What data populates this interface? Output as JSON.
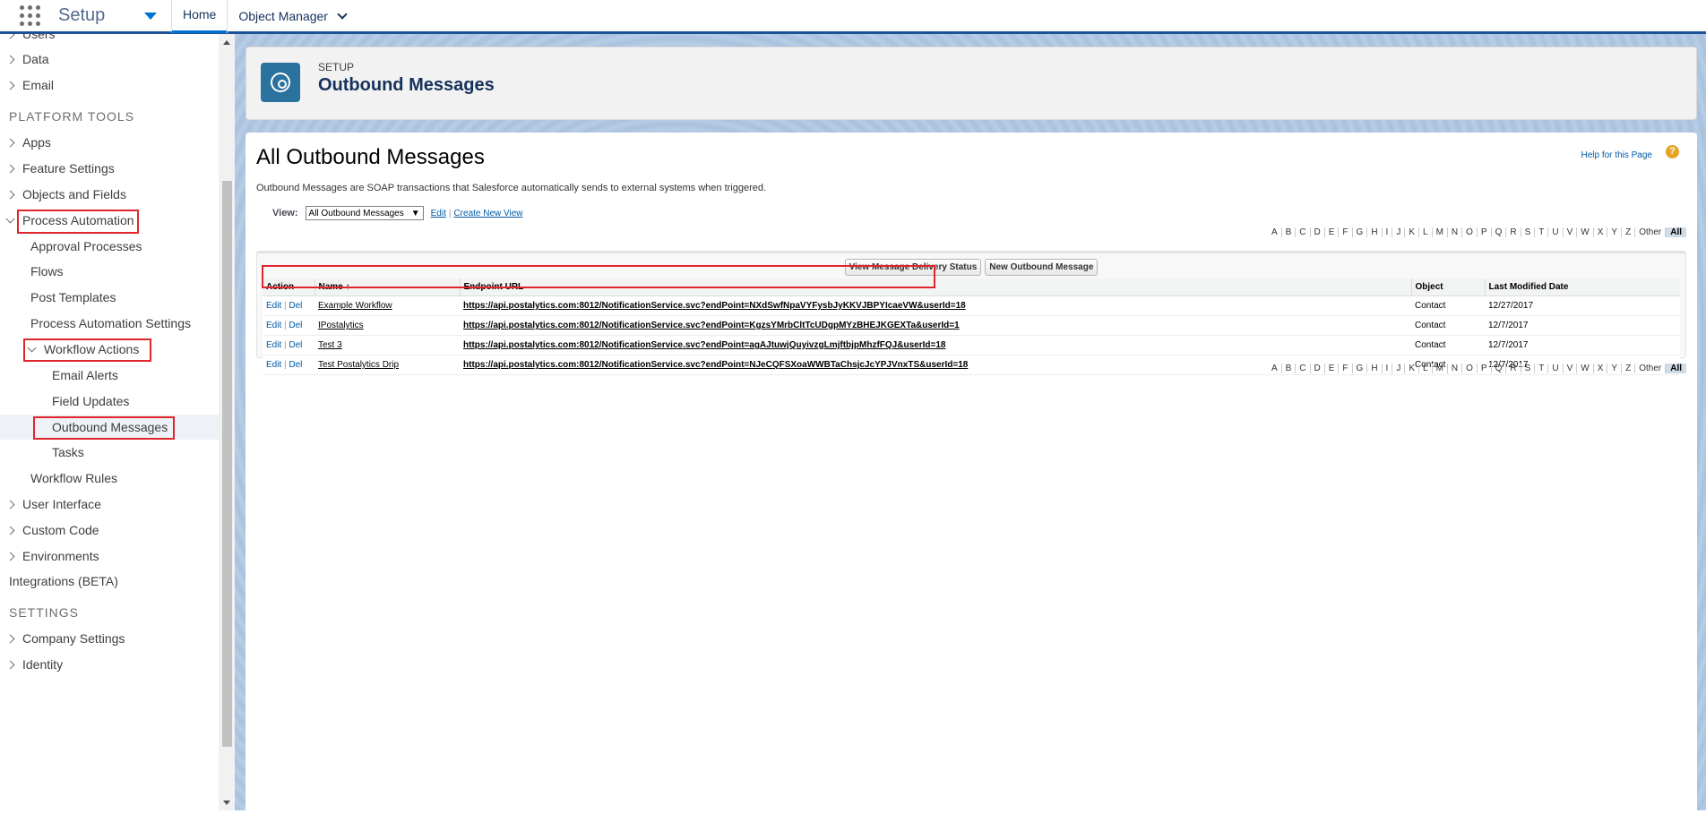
{
  "topbar": {
    "app_name": "Setup",
    "tabs": [
      {
        "label": "Home"
      },
      {
        "label": "Object Manager"
      }
    ]
  },
  "sidebar": {
    "items": {
      "users": "Users",
      "data": "Data",
      "email": "Email",
      "platform_tools": "PLATFORM TOOLS",
      "apps": "Apps",
      "feature_settings": "Feature Settings",
      "objects_and_fields": "Objects and Fields",
      "process_automation": "Process Automation",
      "approval_processes": "Approval Processes",
      "flows": "Flows",
      "post_templates": "Post Templates",
      "process_automation_settings": "Process Automation Settings",
      "workflow_actions": "Workflow Actions",
      "email_alerts": "Email Alerts",
      "field_updates": "Field Updates",
      "outbound_messages": "Outbound Messages",
      "tasks": "Tasks",
      "workflow_rules": "Workflow Rules",
      "user_interface": "User Interface",
      "custom_code": "Custom Code",
      "environments": "Environments",
      "integrations": "Integrations (BETA)",
      "settings": "SETTINGS",
      "company_settings": "Company Settings",
      "identity": "Identity"
    }
  },
  "header": {
    "eyebrow": "SETUP",
    "title": "Outbound Messages"
  },
  "content": {
    "title": "All Outbound Messages",
    "help": "Help for this Page",
    "help_icon": "?",
    "description": "Outbound Messages are SOAP transactions that Salesforce automatically sends to external systems when triggered.",
    "view_label": "View:",
    "view_selected": "All Outbound Messages",
    "edit_link": "Edit",
    "create_view_link": "Create New View",
    "alphabet": [
      "A",
      "B",
      "C",
      "D",
      "E",
      "F",
      "G",
      "H",
      "I",
      "J",
      "K",
      "L",
      "M",
      "N",
      "O",
      "P",
      "Q",
      "R",
      "S",
      "T",
      "U",
      "V",
      "W",
      "X",
      "Y",
      "Z",
      "Other",
      "All"
    ],
    "buttons": {
      "delivery_status": "View Message Delivery Status",
      "new_message": "New Outbound Message"
    },
    "columns": {
      "action": "Action",
      "name": "Name",
      "sort_arrow": "↑",
      "endpoint": "Endpoint URL",
      "object": "Object",
      "modified": "Last Modified Date"
    },
    "action_edit": "Edit",
    "action_del": "Del",
    "rows": [
      {
        "name": "Example Workflow",
        "endpoint": "https://api.postalytics.com:8012/NotificationService.svc?endPoint=NXdSwfNpaVYFysbJyKKVJBPYIcaeVW&userId=18",
        "object": "Contact",
        "modified": "12/27/2017"
      },
      {
        "name": "IPostalytics",
        "endpoint": "https://api.postalytics.com:8012/NotificationService.svc?endPoint=KgzsYMrbCltTcUDgpMYzBHEJKGEXTa&userId=1",
        "object": "Contact",
        "modified": "12/7/2017"
      },
      {
        "name": "Test 3",
        "endpoint": "https://api.postalytics.com:8012/NotificationService.svc?endPoint=agAJtuwjQuyivzgLmjftbjpMhzfFQJ&userId=18",
        "object": "Contact",
        "modified": "12/7/2017"
      },
      {
        "name": "Test Postalytics Drip",
        "endpoint": "https://api.postalytics.com:8012/NotificationService.svc?endPoint=NJeCQFSXoaWWBTaChsjcJcYPJVnxTS&userId=18",
        "object": "Contact",
        "modified": "12/7/2017"
      }
    ]
  }
}
